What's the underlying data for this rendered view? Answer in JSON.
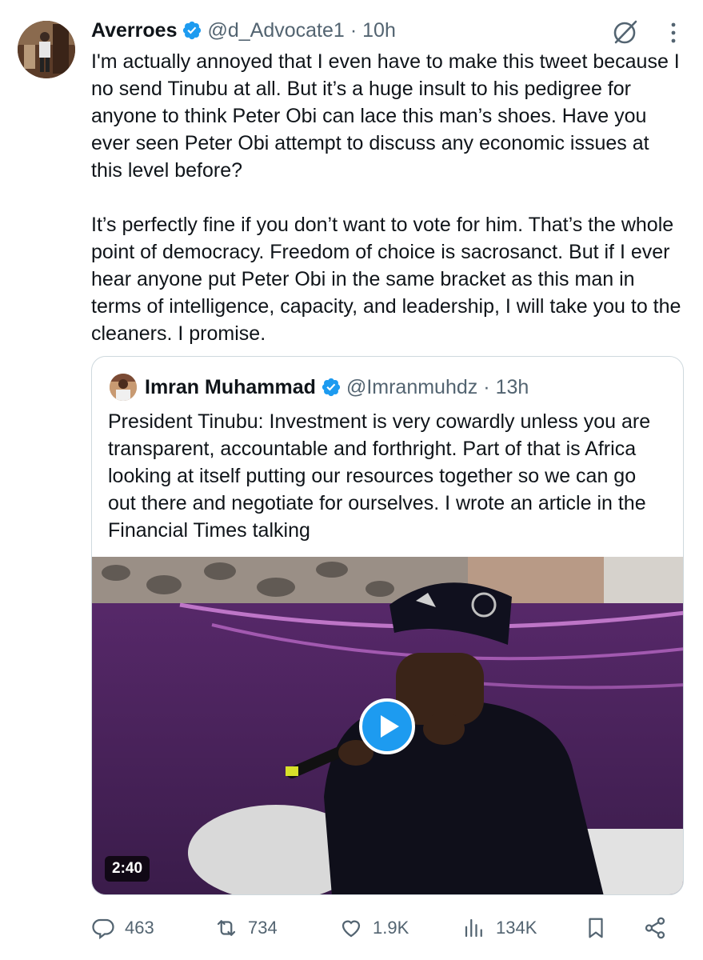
{
  "tweet": {
    "author_name": "Averroes",
    "handle": "@d_Advocate1",
    "separator": "·",
    "time": "10h",
    "text": "I'm actually annoyed that I even have to make this tweet because I no send Tinubu at all. But it’s a huge insult to his pedigree for anyone to think Peter Obi can lace this man’s shoes. Have you ever seen Peter Obi attempt to discuss any economic issues at this level before?\n\nIt’s perfectly fine if you don’t want to vote for him. That’s the whole point of democracy. Freedom of choice is sacrosanct. But if I ever hear anyone put Peter Obi in the same bracket as this man in terms of intelligence, capacity, and leadership, I will take you to the cleaners. I promise."
  },
  "quote": {
    "author_name": "Imran Muhammad",
    "handle": "@Imranmuhdz",
    "separator": "·",
    "time": "13h",
    "text": "President Tinubu: Investment is very cowardly unless you are transparent, accountable and forthright. Part of that is Africa looking at itself putting our resources together so we can go out there and negotiate for ourselves. I wrote an article in the Financial Times talking",
    "video_duration": "2:40"
  },
  "actions": {
    "replies": "463",
    "reposts": "734",
    "likes": "1.9K",
    "views": "134K"
  },
  "icons": [
    "verified-badge-icon",
    "grok-icon",
    "more-icon",
    "play-icon",
    "reply-icon",
    "repost-icon",
    "like-icon",
    "views-icon",
    "bookmark-icon",
    "share-icon"
  ],
  "colors": {
    "verified": "#1d9bf0",
    "secondary_text": "#536471",
    "border": "#cfd9de",
    "play": "#1d9bf0"
  }
}
